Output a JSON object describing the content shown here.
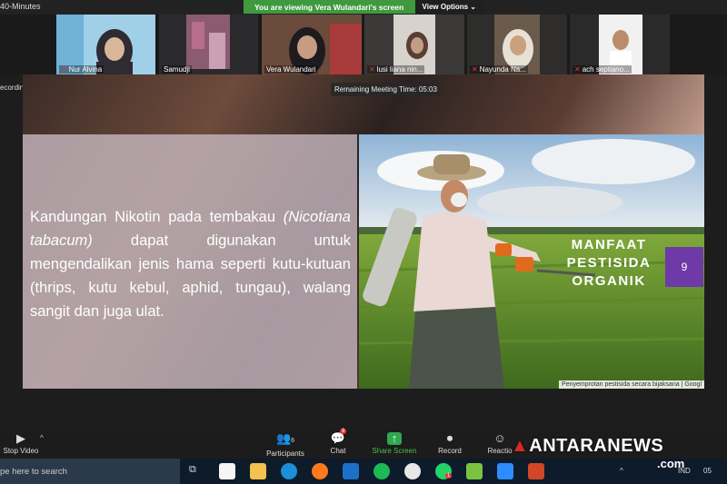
{
  "window": {
    "title": "40-Minutes"
  },
  "share_banner": {
    "text": "You are viewing Vera Wulandari's screen",
    "view_options": "View Options ⌄"
  },
  "participants": [
    {
      "name": "Nur Alvina",
      "muted": true
    },
    {
      "name": "Samudji",
      "muted": false
    },
    {
      "name": "Vera Wulandari",
      "muted": false
    },
    {
      "name": "lusi liana nin...",
      "muted": true
    },
    {
      "name": "Nayunda Na...",
      "muted": true
    },
    {
      "name": "ach septiano...",
      "muted": true
    }
  ],
  "meeting": {
    "recording_label": "ecording",
    "remaining_time": "Remaining Meeting Time: 05:03"
  },
  "slide": {
    "body_part1": "Kandungan Nikotin pada tembakau ",
    "body_italic": "(Nicotiana  tabacum)",
    "body_part2": " dapat digunakan untuk mengendalikan jenis hama seperti kutu-kutuan (thrips, kutu kebul, aphid, tungau), walang sangit dan juga ulat.",
    "title_line1": "MANFAAT",
    "title_line2": "PESTISIDA",
    "title_line3": "ORGANIK",
    "page_number": "9",
    "caption": "Penyemprotan pestisida secara bijaksana | Googl"
  },
  "controls": {
    "stop_video": "Stop Video",
    "participants": "Participants",
    "participants_count": "6",
    "chat": "Chat",
    "chat_badge": "9",
    "share_screen": "Share Screen",
    "record": "Record",
    "reactions": "Reactio"
  },
  "taskbar": {
    "search_placeholder": "pe here to search",
    "whatsapp_badge": "1",
    "language": "IND",
    "time_fragment": "05"
  },
  "watermark": {
    "brand": "ANTARANEWS",
    "suffix": ".com"
  },
  "colors": {
    "share_green": "#3f9a3f",
    "badge_purple": "#6d3aa8",
    "active_outline": "#8fd16b"
  }
}
